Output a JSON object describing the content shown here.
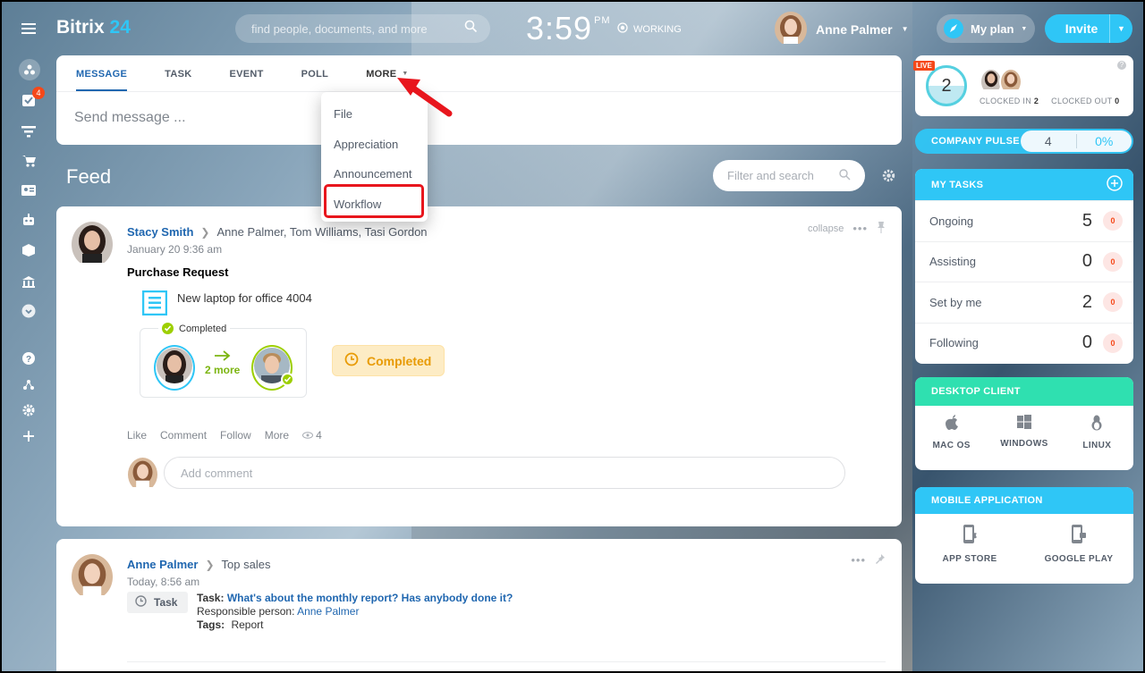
{
  "header": {
    "brand_main": "Bitrix",
    "brand_num": "24",
    "search_placeholder": "find people, documents, and more",
    "clock": "3:59",
    "clock_suffix": "PM",
    "working": "WORKING",
    "user_name": "Anne Palmer",
    "my_plan": "My plan",
    "invite": "Invite"
  },
  "sidebar": {
    "tasks_badge": "4"
  },
  "composer": {
    "tabs": [
      "MESSAGE",
      "TASK",
      "EVENT",
      "POLL",
      "MORE"
    ],
    "placeholder": "Send message ..."
  },
  "more_menu": {
    "items": [
      "File",
      "Appreciation",
      "Announcement",
      "Workflow"
    ]
  },
  "feed": {
    "title": "Feed",
    "filter_placeholder": "Filter and search",
    "post1": {
      "author": "Stacy Smith",
      "recipients": "Anne Palmer, Tom Williams, Tasi Gordon",
      "date": "January 20 9:36 am",
      "collapse": "collapse",
      "title": "Purchase Request",
      "doc": "New laptop for office 4004",
      "wf_status": "Completed",
      "wf_more": "2 more",
      "status_label": "Completed",
      "actions": [
        "Like",
        "Comment",
        "Follow",
        "More"
      ],
      "views": "4",
      "comment_placeholder": "Add comment"
    },
    "post2": {
      "author": "Anne Palmer",
      "recipients": "Top sales",
      "date": "Today, 8:56 am",
      "task_badge": "Task",
      "task_label": "Task:",
      "task_title": "What's about the monthly report? Has anybody done it?",
      "responsible_label": "Responsible person:",
      "responsible": "Anne Palmer",
      "tags_label": "Tags:",
      "tags": "Report"
    }
  },
  "right": {
    "live": "LIVE",
    "clocked_count": "2",
    "clocked_in_label": "CLOCKED IN",
    "clocked_in": "2",
    "clocked_out_label": "CLOCKED OUT",
    "clocked_out": "0",
    "pulse_label": "COMPANY PULSE",
    "pulse_value": "4",
    "pulse_percent": "0%",
    "my_tasks": {
      "title": "MY TASKS",
      "rows": [
        {
          "label": "Ongoing",
          "count": "5",
          "badge": "0"
        },
        {
          "label": "Assisting",
          "count": "0",
          "badge": "0"
        },
        {
          "label": "Set by me",
          "count": "2",
          "badge": "0"
        },
        {
          "label": "Following",
          "count": "0",
          "badge": "0"
        }
      ]
    },
    "desktop": {
      "title": "DESKTOP CLIENT",
      "items": [
        "MAC OS",
        "WINDOWS",
        "LINUX"
      ]
    },
    "mobile": {
      "title": "MOBILE APPLICATION",
      "items": [
        "APP STORE",
        "GOOGLE PLAY"
      ]
    }
  },
  "colors": {
    "accent": "#2fc6f6",
    "link": "#2067b0",
    "highlight": "#e8161d",
    "completed": "#e89b06"
  }
}
